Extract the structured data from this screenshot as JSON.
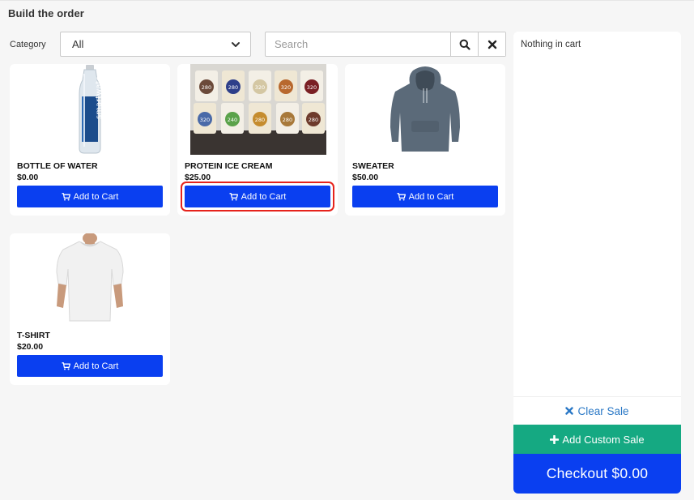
{
  "header": {
    "title": "Build the order"
  },
  "filters": {
    "category_label": "Category",
    "category_selected": "All",
    "search_placeholder": "Search",
    "search_value": ""
  },
  "icons": {
    "search": "search-icon",
    "clear": "close-icon",
    "cart": "shopping-cart-icon",
    "chevron": "chevron-down-icon",
    "plus": "plus-icon"
  },
  "products": [
    {
      "name": "BOTTLE OF WATER",
      "price": "$0.00",
      "button": "Add to Cart",
      "image": "water-bottle"
    },
    {
      "name": "PROTEIN ICE CREAM",
      "price": "$25.00",
      "button": "Add to Cart",
      "image": "ice-cream-pints"
    },
    {
      "name": "SWEATER",
      "price": "$50.00",
      "button": "Add to Cart",
      "image": "grey-hoodie"
    },
    {
      "name": "T-SHIRT",
      "price": "$20.00",
      "button": "Add to Cart",
      "image": "white-tshirt"
    }
  ],
  "cart": {
    "empty_text": "Nothing in cart",
    "clear_label": "Clear Sale",
    "custom_sale_label": "Add Custom Sale",
    "checkout_label": "Checkout $0.00"
  },
  "pint_labels": [
    "280",
    "280",
    "320",
    "320",
    "320",
    "320",
    "240",
    "280",
    "280",
    "280"
  ],
  "colors": {
    "primary": "#0a3ff0",
    "success": "#15a982",
    "link": "#2a78c6",
    "highlight": "#e6231c"
  }
}
